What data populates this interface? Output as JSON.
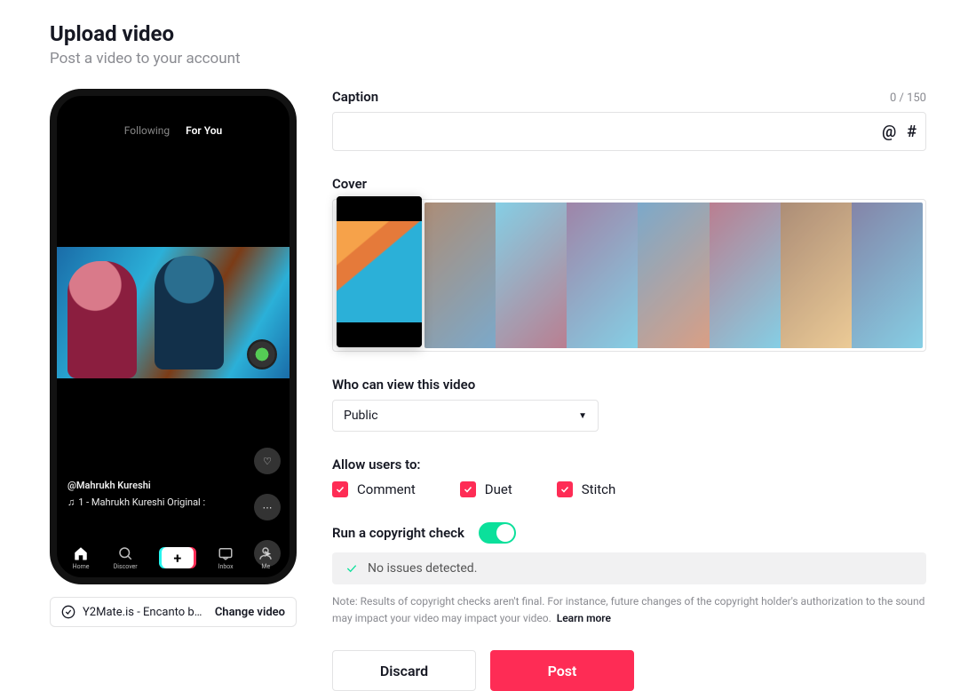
{
  "page": {
    "title": "Upload video",
    "subtitle": "Post a video to your account"
  },
  "phone": {
    "tabs": {
      "following": "Following",
      "foryou": "For You"
    },
    "username": "@Mahrukh Kureshi",
    "sound": "1 - Mahrukh Kureshi Original :",
    "nav": {
      "home": "Home",
      "discover": "Discover",
      "inbox": "Inbox",
      "me": "Me"
    }
  },
  "file": {
    "name": "Y2Mate.is - Encanto bu...",
    "change_label": "Change video"
  },
  "caption": {
    "label": "Caption",
    "counter": "0 / 150",
    "value": "",
    "mention": "@",
    "hashtag": "#"
  },
  "cover": {
    "label": "Cover"
  },
  "privacy": {
    "label": "Who can view this video",
    "selected": "Public"
  },
  "allow": {
    "label": "Allow users to:",
    "options": [
      {
        "key": "comment",
        "label": "Comment",
        "checked": true
      },
      {
        "key": "duet",
        "label": "Duet",
        "checked": true
      },
      {
        "key": "stitch",
        "label": "Stitch",
        "checked": true
      }
    ]
  },
  "copyright": {
    "label": "Run a copyright check",
    "enabled": true,
    "status": "No issues detected.",
    "note": "Note: Results of copyright checks aren't final. For instance, future changes of the copyright holder's authorization to the sound may impact your video may impact your video.",
    "learn": "Learn more"
  },
  "actions": {
    "discard": "Discard",
    "post": "Post"
  }
}
